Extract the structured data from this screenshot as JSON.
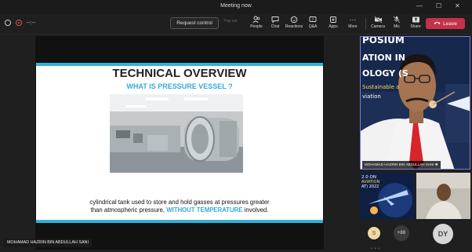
{
  "window": {
    "title": "Meeting now",
    "minimize": "—",
    "maximize": "☐",
    "close": "✕"
  },
  "toolbar": {
    "timer": "--:--",
    "request_control": "Request control",
    "pop_out": "Pop out",
    "buttons": [
      {
        "label": "People",
        "icon": "people-icon"
      },
      {
        "label": "Chat",
        "icon": "chat-icon"
      },
      {
        "label": "Reactions",
        "icon": "reactions-icon"
      },
      {
        "label": "Q&A",
        "icon": "qa-icon"
      },
      {
        "label": "Apps",
        "icon": "apps-icon"
      },
      {
        "label": "More",
        "icon": "more-icon"
      },
      {
        "label": "Camera",
        "icon": "camera-off-icon"
      },
      {
        "label": "Mic",
        "icon": "mic-off-icon"
      },
      {
        "label": "Share",
        "icon": "share-icon"
      }
    ],
    "leave": "Leave",
    "leave_color": "#c4314b"
  },
  "slide": {
    "title": "TECHNICAL OVERVIEW",
    "subtitle": "WHAT IS PRESSURE VESSEL ?",
    "body_line1": "cylindrical tank used to store and hold gasses at pressures greater",
    "body_line2_a": "than atmospheric pressure, ",
    "body_line2_b": "WITHOUT TEMPERATURE",
    "body_line2_c": " involved.",
    "accent": "#35aad6"
  },
  "presenter_name": "MOHAMAD HAZRIN BIN ABDULLAH SANI",
  "video": {
    "name": "MOHAMAD HAZRIN BIN ABDULLAH SANI",
    "bg_text_1": "POSIUM",
    "bg_text_2": "ATION IN",
    "bg_text_3": "OLOGY (S",
    "bg_text_4": "Sustainable a",
    "bg_text_5": "viation"
  },
  "thumb1_text": [
    "2.0 ON",
    "AVIATION",
    "AT) 2022"
  ],
  "participants": {
    "s_initial": "S",
    "more": "+88",
    "dy_initials": "DY"
  }
}
